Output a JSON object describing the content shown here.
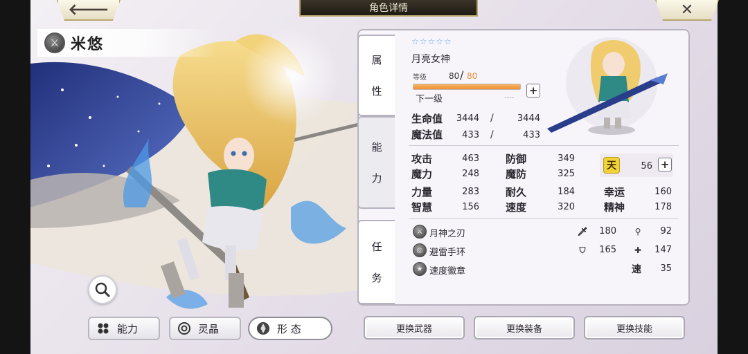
{
  "header": {
    "title": "角色详情",
    "back_icon": "arrow-left-icon",
    "close_icon": "close-icon"
  },
  "character": {
    "name": "米悠",
    "rarity_stars": "☆☆☆☆☆",
    "title": "月亮女神"
  },
  "side_tabs": {
    "attribute": [
      "属",
      "性"
    ],
    "ability": [
      "能",
      "力"
    ],
    "mission": [
      "任",
      "务"
    ]
  },
  "level": {
    "label": "等级",
    "current": "80",
    "separator": "/",
    "max": "80",
    "progress": 1.0,
    "next_label": "下一级",
    "next_value": "----"
  },
  "vitals": [
    {
      "label": "生命值",
      "current": "3444",
      "sep": "/",
      "max": "3444"
    },
    {
      "label": "魔法值",
      "current": "433",
      "sep": "/",
      "max": "433"
    }
  ],
  "stats": {
    "attack": {
      "label": "攻击",
      "value": "463"
    },
    "defense": {
      "label": "防御",
      "value": "349"
    },
    "magic": {
      "label": "魔力",
      "value": "248"
    },
    "magic_def": {
      "label": "魔防",
      "value": "325"
    },
    "strength": {
      "label": "力量",
      "value": "283"
    },
    "endurance": {
      "label": "耐久",
      "value": "184"
    },
    "luck": {
      "label": "幸运",
      "value": "160"
    },
    "wisdom": {
      "label": "智慧",
      "value": "156"
    },
    "speed": {
      "label": "速度",
      "value": "320"
    },
    "spirit": {
      "label": "精神",
      "value": "178"
    }
  },
  "heaven": {
    "icon_text": "天",
    "value": "56"
  },
  "equipment": [
    {
      "name": "月神之刃",
      "stat1_icon": "sword-icon",
      "stat1": "180",
      "stat2_icon": "wand-icon",
      "stat2": "92"
    },
    {
      "name": "避雷手环",
      "stat1_icon": "shield-icon",
      "stat1": "165",
      "stat2_icon": "cross-shield-icon",
      "stat2": "147"
    },
    {
      "name": "速度徽章",
      "stat3_label": "速",
      "stat3": "35"
    }
  ],
  "tabs": {
    "ability": "能力",
    "crystal": "灵晶",
    "form": "形 态"
  },
  "actions": {
    "weapon": "更换武器",
    "equip": "更换装备",
    "skill": "更换技能"
  },
  "colors": {
    "accent_gold": "#b9a66b",
    "star_blue": "#5aa2e0",
    "level_orange": "#f08f2f",
    "heaven_yellow": "#f1d338"
  }
}
